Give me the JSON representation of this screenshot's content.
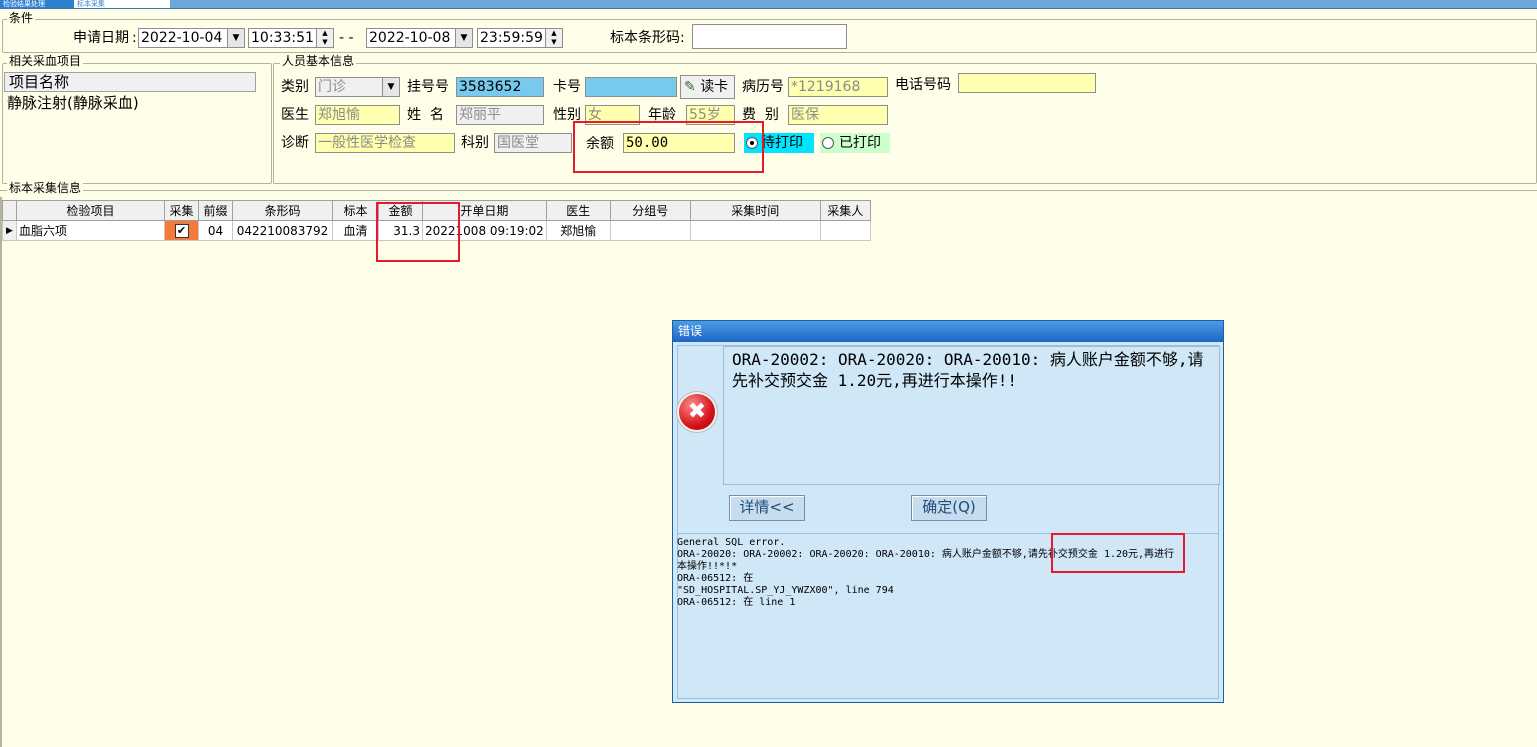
{
  "top_tabs": [
    "检验结果处理",
    "标本采集"
  ],
  "condition": {
    "group_label": "条件",
    "date_label": "申请日期",
    "start_date": "2022-10-04",
    "start_time": "10:33:51",
    "separator": "- -",
    "end_date": "2022-10-08",
    "end_time": "23:59:59",
    "barcode_label": "标本条形码:",
    "barcode_value": ""
  },
  "related_items": {
    "group_label": "相关采血项目",
    "column_header": "项目名称",
    "rows": [
      "静脉注射(静脉采血)"
    ]
  },
  "patient": {
    "group_label": "人员基本信息",
    "type_label": "类别",
    "type_value": "门诊",
    "reg_no_label": "挂号号",
    "reg_no_value": "3583652",
    "card_no_label": "卡号",
    "card_no_value": "",
    "read_card_label": "读卡",
    "record_no_label": "病历号",
    "record_no_value": "*1219168",
    "phone_label": "电话号码",
    "phone_value": "",
    "doctor_label": "医生",
    "doctor_value": "郑旭愉",
    "name_label": "姓  名",
    "name_value": "郑丽平",
    "gender_label": "性别",
    "gender_value": "女",
    "age_label": "年龄",
    "age_value": "55岁",
    "fee_label": "费  别",
    "fee_value": "医保",
    "diagnosis_label": "诊断",
    "diagnosis_value": "一般性医学检查",
    "department_label": "科别",
    "department_value": "国医堂",
    "balance_label": "余额",
    "balance_value": "50.00",
    "pending_print_label": "待打印",
    "printed_label": "已打印",
    "selected_print_option": "待打印"
  },
  "specimen": {
    "group_label": "标本采集信息",
    "columns": [
      "检验项目",
      "采集",
      "前缀",
      "条形码",
      "标本",
      "金额",
      "开单日期",
      "医生",
      "分组号",
      "采集时间",
      "采集人"
    ],
    "rows": [
      {
        "item": "血脂六项",
        "collect": true,
        "prefix": "04",
        "barcode": "042210083792",
        "specimen": "血清",
        "amount": "31.3",
        "order_date": "20221008 09:19:02",
        "doctor": "郑旭愉",
        "group_no": "",
        "collect_time": "",
        "collector": ""
      }
    ]
  },
  "error_dialog": {
    "title": "错误",
    "message": "ORA-20002: ORA-20020: ORA-20010: 病人账户金额不够,请先补交预交金 1.20元,再进行本操作!!",
    "details_button": "详情<<",
    "ok_button": "确定(Q)",
    "detail_lines": [
      "General SQL error.",
      "ORA-20020: ORA-20002: ORA-20020: ORA-20010: 病人账户金额不够,请先补交预交金 1.20元,再进行",
      "本操作!!*!*",
      "ORA-06512: 在",
      "\"SD_HOSPITAL.SP_YJ_YWZX00\", line 794",
      "ORA-06512: 在 line 1"
    ]
  },
  "colors": {
    "background": "#fffee8",
    "highlight_red": "#e8192c",
    "input_yellow": "#ffffb0",
    "card_field_blue": "#77c9ee",
    "pending_print_bg": "#00e5ff",
    "printed_bg": "#ccffcc",
    "dialog_bg": "#cfe7f7"
  }
}
